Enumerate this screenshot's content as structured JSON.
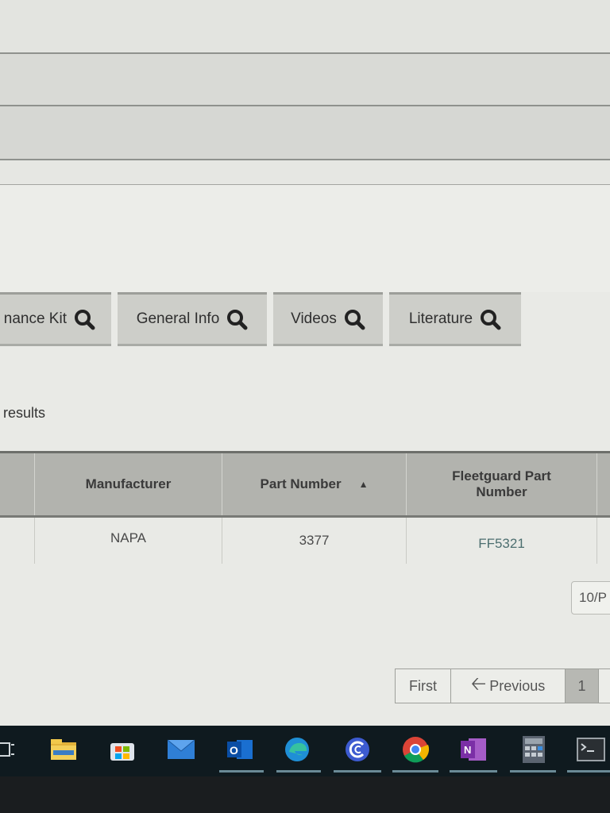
{
  "tabs": [
    {
      "label": "nance Kit",
      "icon": "search-icon"
    },
    {
      "label": "General Info",
      "icon": "search-icon"
    },
    {
      "label": "Videos",
      "icon": "search-icon"
    },
    {
      "label": "Literature",
      "icon": "search-icon"
    }
  ],
  "results_text": "results",
  "table": {
    "headers": [
      "",
      "Manufacturer",
      "Part Number",
      "Fleetguard Part Number",
      ""
    ],
    "sort_indicator": "▲",
    "rows": [
      [
        "",
        "NAPA",
        "3377",
        "FF5321",
        ""
      ]
    ]
  },
  "per_page": "10/P",
  "pagination": {
    "first": "First",
    "previous": "Previous",
    "current_page": "1"
  },
  "taskbar": {
    "apps": [
      "task-view-icon",
      "file-explorer-icon",
      "store-icon",
      "mail-icon",
      "outlook-icon",
      "edge-icon",
      "app-icon",
      "chrome-icon",
      "onenote-icon",
      "calculator-icon",
      "terminal-icon"
    ]
  },
  "colors": {
    "page_bg": "#e9eae6",
    "tab_bg": "#cdcec9",
    "header_bg": "#b2b3ae",
    "link": "#4d6f70",
    "taskbar_bg": "#0f1a1f"
  }
}
